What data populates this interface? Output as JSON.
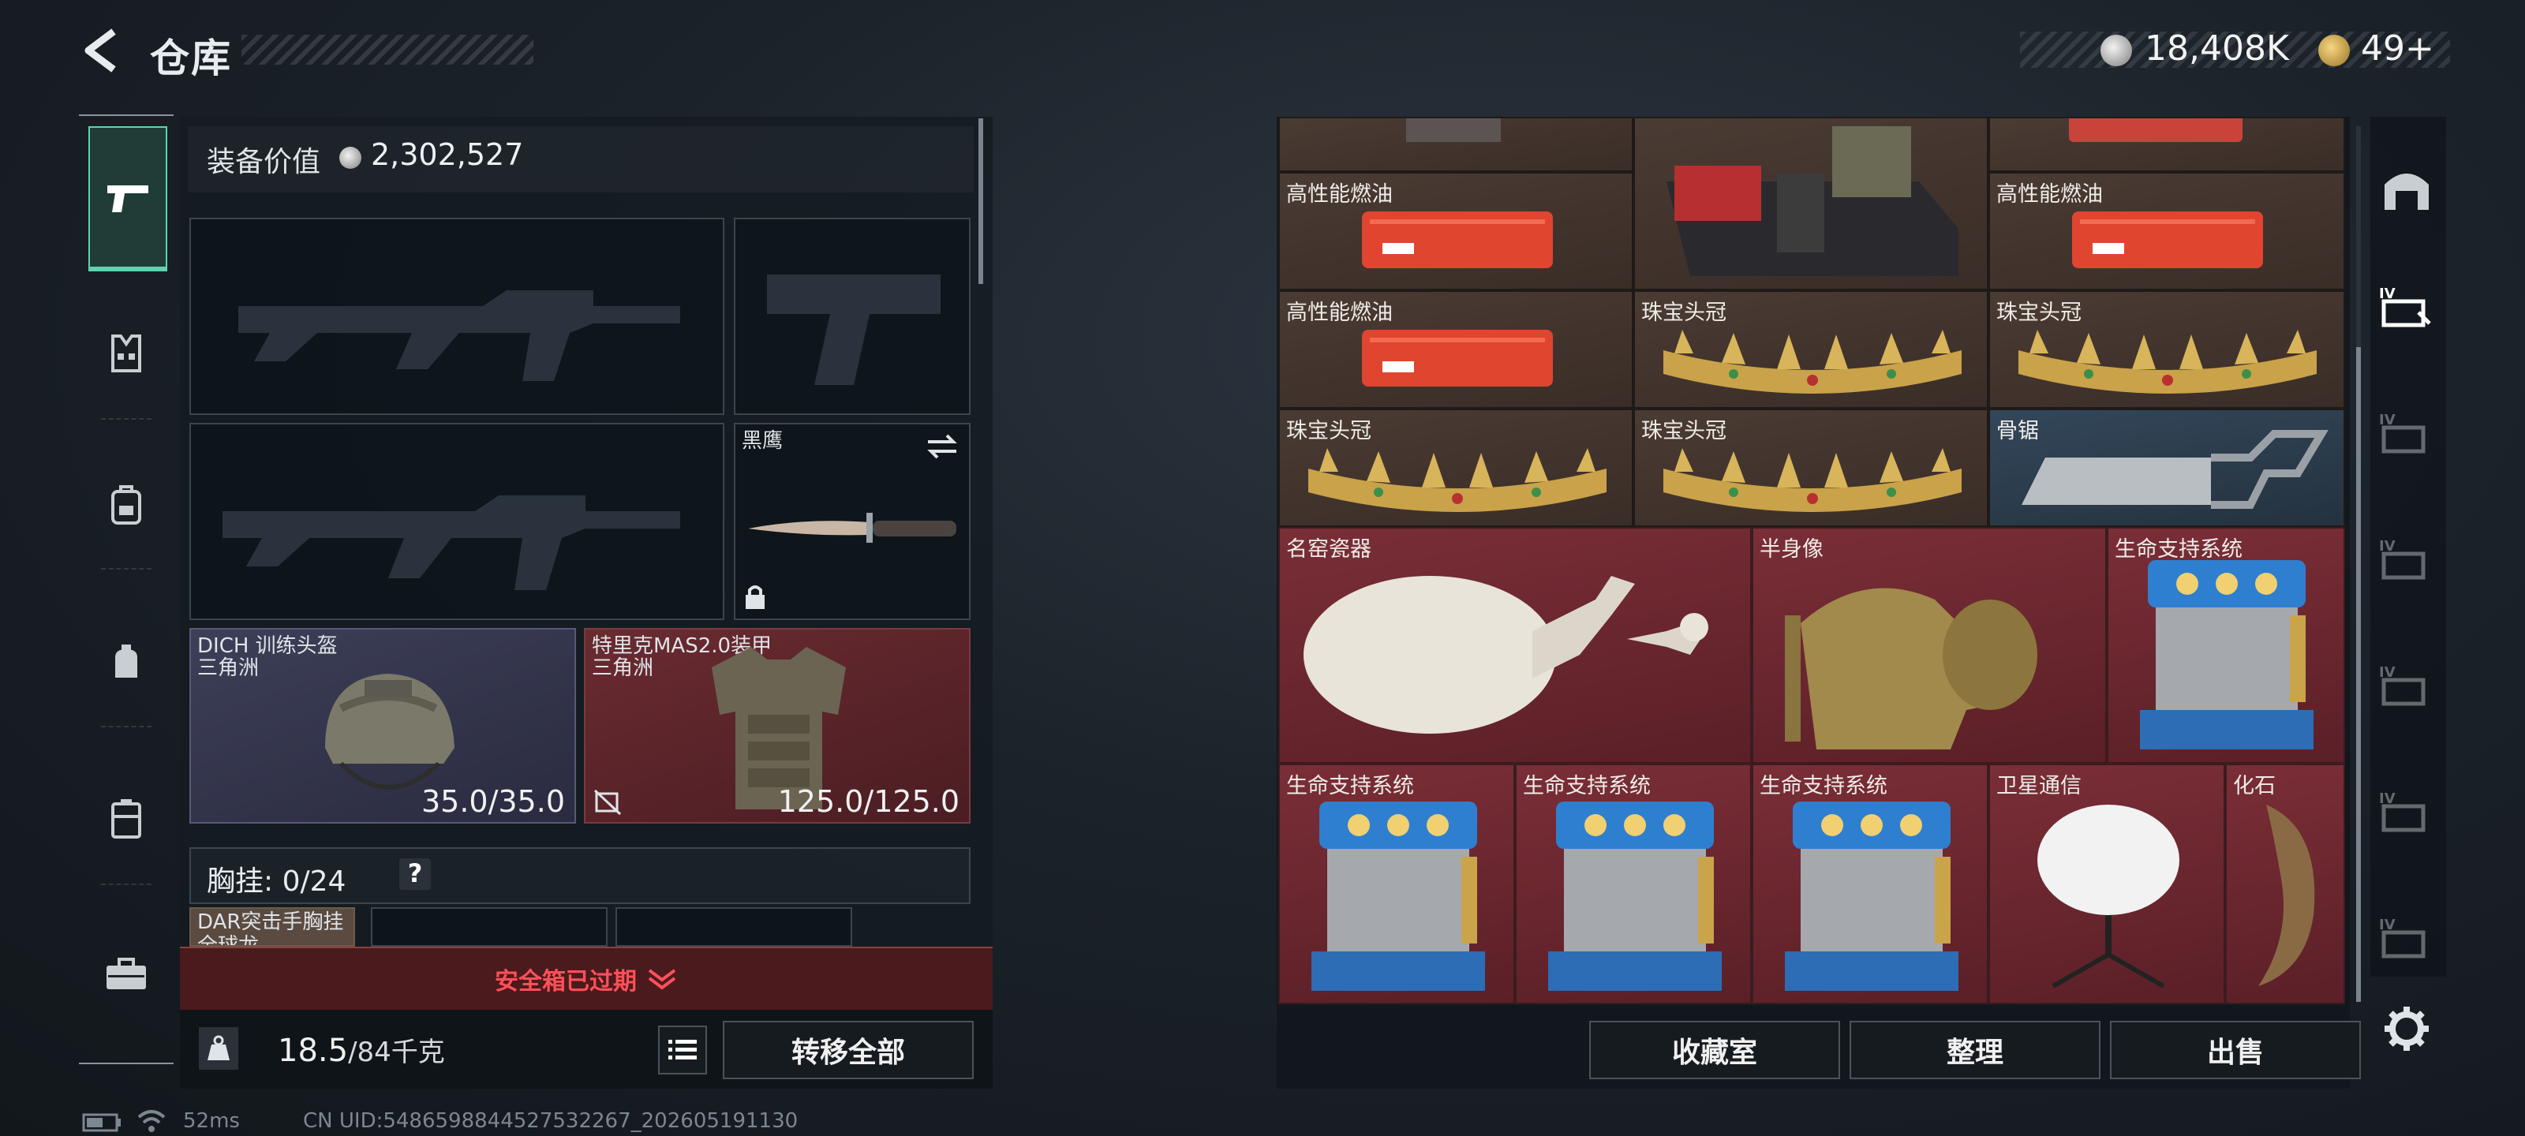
{
  "header": {
    "title": "仓库",
    "currency_main": "18,408K",
    "currency_premium": "49+"
  },
  "loadout": {
    "value_label": "装备价值",
    "value": "2,302,527",
    "knife_name": "黑鹰",
    "helmet_name": "DICH 训练头盔",
    "helmet_sub": "三角洲",
    "helmet_dur": "35.0/35.0",
    "armor_name": "特里克MAS2.0装甲",
    "armor_sub": "三角洲",
    "armor_dur": "125.0/125.0",
    "chest_label": "胸挂: 0/24",
    "chest_help": "?",
    "chest_item": "DAR突击手胸挂",
    "chest_item_sub": "全球龙",
    "safe_box_status": "安全箱已过期",
    "weight_current": "18.5",
    "weight_max": "/84千克",
    "transfer_all": "转移全部"
  },
  "storage": {
    "items": [
      {
        "label": "高性能燃油"
      },
      {
        "label": "高性能燃油"
      },
      {
        "label": "高性能燃油"
      },
      {
        "label": "珠宝头冠"
      },
      {
        "label": "珠宝头冠"
      },
      {
        "label": "珠宝头冠"
      },
      {
        "label": "珠宝头冠"
      },
      {
        "label": "骨锯"
      },
      {
        "label": "名窑瓷器"
      },
      {
        "label": "半身像"
      },
      {
        "label": "生命支持系统"
      },
      {
        "label": "生命支持系统"
      },
      {
        "label": "生命支持系统"
      },
      {
        "label": "生命支持系统"
      },
      {
        "label": "卫星通信"
      },
      {
        "label": "化石"
      }
    ],
    "buttons": {
      "collection": "收藏室",
      "sort": "整理",
      "sell": "出售"
    }
  },
  "status_bar": {
    "ping": "52ms",
    "uid": "CN UID:5486598844527532267_202605191130"
  },
  "colors": {
    "accent": "#5fd3b0",
    "alert": "#ff5058",
    "rare_red": "#6a2530"
  }
}
